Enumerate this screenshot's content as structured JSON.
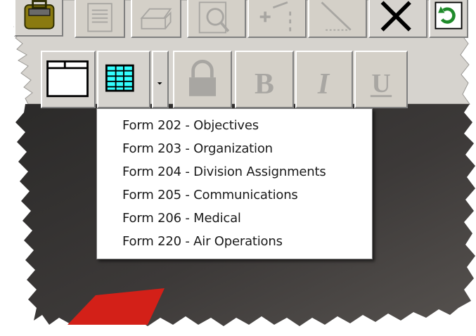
{
  "toolbar": {
    "top_row": [
      {
        "name": "briefcase-icon"
      },
      {
        "name": "document-icon"
      },
      {
        "name": "printer-icon"
      },
      {
        "name": "print-preview-icon"
      },
      {
        "name": "add-item-icon"
      },
      {
        "name": "pencil-icon"
      },
      {
        "name": "delete-icon"
      },
      {
        "name": "refresh-icon"
      }
    ],
    "second_row": [
      {
        "name": "new-window-icon"
      },
      {
        "name": "form-grid-icon"
      },
      {
        "name": "dropdown-arrow-icon"
      },
      {
        "name": "lock-icon"
      },
      {
        "name": "bold-icon"
      },
      {
        "name": "italic-icon"
      },
      {
        "name": "underline-icon"
      }
    ],
    "bold_glyph": "B",
    "italic_glyph": "I",
    "underline_glyph": "U"
  },
  "dropdown": {
    "items": [
      "Form 202 - Objectives",
      "Form 203 - Organization",
      "Form 204 - Division Assignments",
      "Form 205 - Communications",
      "Form 206 - Medical",
      "Form 220 - Air Operations"
    ]
  },
  "colors": {
    "toolbar_face": "#d6d3ce",
    "canvas_dark": "#3a3736",
    "accent_red": "#d32018",
    "grid_cyan": "#33ffff",
    "refresh_green": "#1f8a2a"
  }
}
